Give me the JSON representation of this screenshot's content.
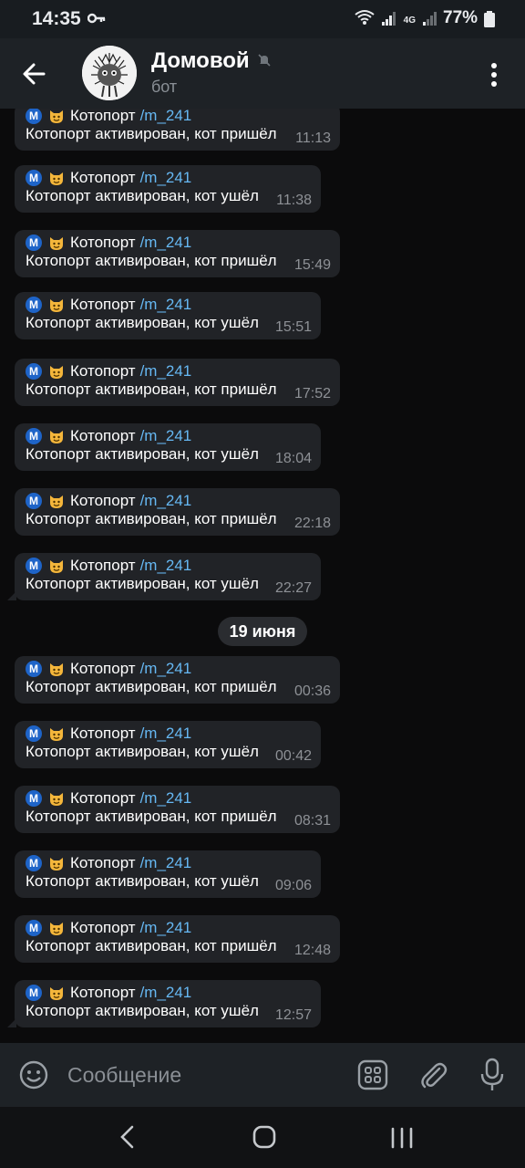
{
  "status_bar": {
    "time": "14:35",
    "network": "4G",
    "battery": "77%"
  },
  "header": {
    "title": "Домовой",
    "subtitle": "бот"
  },
  "messages": [
    {
      "badge": "M",
      "label": "Котопорт",
      "link": "/m_241",
      "text": "Котопорт активирован, кот пришёл",
      "time": "11:13"
    },
    {
      "badge": "M",
      "label": "Котопорт",
      "link": "/m_241",
      "text": "Котопорт активирован, кот ушёл",
      "time": "11:38"
    },
    {
      "badge": "M",
      "label": "Котопорт",
      "link": "/m_241",
      "text": "Котопорт активирован, кот пришёл",
      "time": "15:49"
    },
    {
      "badge": "M",
      "label": "Котопорт",
      "link": "/m_241",
      "text": "Котопорт активирован, кот ушёл",
      "time": "15:51"
    },
    {
      "badge": "M",
      "label": "Котопорт",
      "link": "/m_241",
      "text": "Котопорт активирован, кот пришёл",
      "time": "17:52"
    },
    {
      "badge": "M",
      "label": "Котопорт",
      "link": "/m_241",
      "text": "Котопорт активирован, кот ушёл",
      "time": "18:04"
    },
    {
      "badge": "M",
      "label": "Котопорт",
      "link": "/m_241",
      "text": "Котопорт активирован, кот пришёл",
      "time": "22:18"
    },
    {
      "badge": "M",
      "label": "Котопорт",
      "link": "/m_241",
      "text": "Котопорт активирован, кот ушёл",
      "time": "22:27"
    },
    {
      "badge": "M",
      "label": "Котопорт",
      "link": "/m_241",
      "text": "Котопорт активирован, кот пришёл",
      "time": "00:36"
    },
    {
      "badge": "M",
      "label": "Котопорт",
      "link": "/m_241",
      "text": "Котопорт активирован, кот ушёл",
      "time": "00:42"
    },
    {
      "badge": "M",
      "label": "Котопорт",
      "link": "/m_241",
      "text": "Котопорт активирован, кот пришёл",
      "time": "08:31"
    },
    {
      "badge": "M",
      "label": "Котопорт",
      "link": "/m_241",
      "text": "Котопорт активирован, кот ушёл",
      "time": "09:06"
    },
    {
      "badge": "M",
      "label": "Котопорт",
      "link": "/m_241",
      "text": "Котопорт активирован, кот пришёл",
      "time": "12:48"
    },
    {
      "badge": "M",
      "label": "Котопорт",
      "link": "/m_241",
      "text": "Котопорт активирован, кот ушёл",
      "time": "12:57"
    }
  ],
  "date_separator": "19 июня",
  "composer": {
    "placeholder": "Сообщение"
  },
  "colors": {
    "link": "#66b8f3",
    "bubble": "#212327",
    "badge": "#1e64c8",
    "background": "#0b0b0c"
  },
  "icons": [
    "key-icon",
    "wifi-icon",
    "signal-icon",
    "battery-icon",
    "back-arrow-icon",
    "mute-icon",
    "more-vert-icon",
    "emoji-icon",
    "bot-commands-icon",
    "attach-icon",
    "mic-icon",
    "nav-back-icon",
    "nav-home-icon",
    "nav-recents-icon"
  ]
}
